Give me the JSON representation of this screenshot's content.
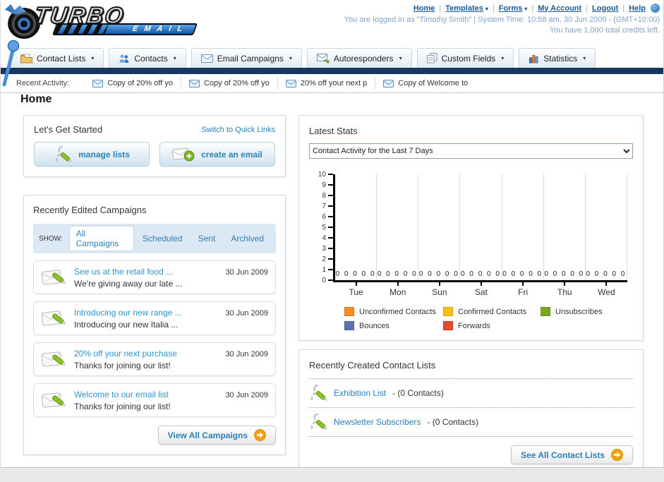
{
  "header": {
    "logo_title": "TURBO",
    "logo_subtitle": "EMAIL",
    "nav_links": [
      {
        "label": "Home",
        "dropdown": false
      },
      {
        "label": "Templates",
        "dropdown": true
      },
      {
        "label": "Forms",
        "dropdown": true
      },
      {
        "label": "My Account",
        "dropdown": false
      },
      {
        "label": "Logout",
        "dropdown": false
      },
      {
        "label": "Help",
        "dropdown": false
      }
    ],
    "login_info": "You are logged in as \"Timothy Smith\" | System Time: 10:58 am, 30 Jun 2009 - (GMT+10:00)",
    "credits_info": "You have 1,000 total credits left."
  },
  "main_nav": {
    "tabs": [
      {
        "label": "Contact Lists",
        "icon": "folder-icon"
      },
      {
        "label": "Contacts",
        "icon": "people-icon"
      },
      {
        "label": "Email Campaigns",
        "icon": "envelope-icon"
      },
      {
        "label": "Autoresponders",
        "icon": "envelope-reply-icon"
      },
      {
        "label": "Custom Fields",
        "icon": "pages-icon"
      },
      {
        "label": "Statistics",
        "icon": "bar-chart-icon"
      }
    ]
  },
  "recent_activity": {
    "label": "Recent Activity:",
    "items": [
      "Copy of 20% off yo",
      "Copy of 20% off yo",
      "20% off your next p",
      "Copy of Welcome to"
    ]
  },
  "page_title": "Home",
  "get_started": {
    "title": "Let's Get Started",
    "switch_link": "Switch to Quick Links",
    "buttons": [
      {
        "label": "manage lists",
        "icon": "person-pencil-icon"
      },
      {
        "label": "create an email",
        "icon": "envelope-plus-icon"
      }
    ]
  },
  "campaigns": {
    "title": "Recently Edited Campaigns",
    "show_label": "SHOW:",
    "tabs": [
      {
        "label": "All Campaigns",
        "active": true
      },
      {
        "label": "Scheduled",
        "active": false
      },
      {
        "label": "Sent",
        "active": false
      },
      {
        "label": "Archived",
        "active": false
      }
    ],
    "rows": [
      {
        "title": "See us at the retail food ...",
        "subtitle": "We're giving away our late ...",
        "date": "30 Jun 2009"
      },
      {
        "title": "Introducing our new range ...",
        "subtitle": "Introducing our new Italia ...",
        "date": "30 Jun 2009"
      },
      {
        "title": "20% off your next purchase",
        "subtitle": "Thanks for joining our list!",
        "date": "30 Jun 2009"
      },
      {
        "title": "Welcome to our email list",
        "subtitle": "Thanks for joining our list!",
        "date": "30 Jun 2009"
      }
    ],
    "view_all_label": "View All Campaigns"
  },
  "stats": {
    "title": "Latest Stats",
    "selected_option": "Contact Activity for the Last 7 Days"
  },
  "chart_data": {
    "type": "bar",
    "title": "Contact Activity for the Last 7 Days",
    "categories": [
      "Tue",
      "Mon",
      "Sun",
      "Sat",
      "Fri",
      "Thu",
      "Wed"
    ],
    "series": [
      {
        "name": "Unconfirmed Contacts",
        "color": "#f68b1f",
        "values": [
          0,
          0,
          0,
          0,
          0,
          0,
          0
        ]
      },
      {
        "name": "Confirmed Contacts",
        "color": "#fcc013",
        "values": [
          0,
          0,
          0,
          0,
          0,
          0,
          0
        ]
      },
      {
        "name": "Unsubscribes",
        "color": "#7aa821",
        "values": [
          0,
          0,
          0,
          0,
          0,
          0,
          0
        ]
      },
      {
        "name": "Bounces",
        "color": "#5a74ad",
        "values": [
          0,
          0,
          0,
          0,
          0,
          0,
          0
        ]
      },
      {
        "name": "Forwards",
        "color": "#e8492e",
        "values": [
          0,
          0,
          0,
          0,
          0,
          0,
          0
        ]
      }
    ],
    "ylim": [
      0,
      10
    ],
    "yticks": [
      0,
      1,
      2,
      3,
      4,
      5,
      6,
      7,
      8,
      9,
      10
    ],
    "xlabel": "",
    "ylabel": "",
    "grid": "vertical separators between day groups",
    "legend_position": "bottom"
  },
  "contact_lists": {
    "title": "Recently Created Contact Lists",
    "items": [
      {
        "name": "Exhibition List",
        "suffix": " - (0 Contacts)",
        "icon": "person-pencil-icon"
      },
      {
        "name": "Newsletter Subscribers",
        "suffix": " - (0 Contacts)",
        "icon": "person-pencil-icon"
      }
    ],
    "see_all_label": "See All Contact Lists"
  },
  "colors": {
    "navbar_dark": "#17375e",
    "link_blue": "#2d7fb5",
    "accent_orange": "#f2a30f",
    "show_bar_bg": "#dce9f5",
    "info_text": "#84a4c9"
  }
}
